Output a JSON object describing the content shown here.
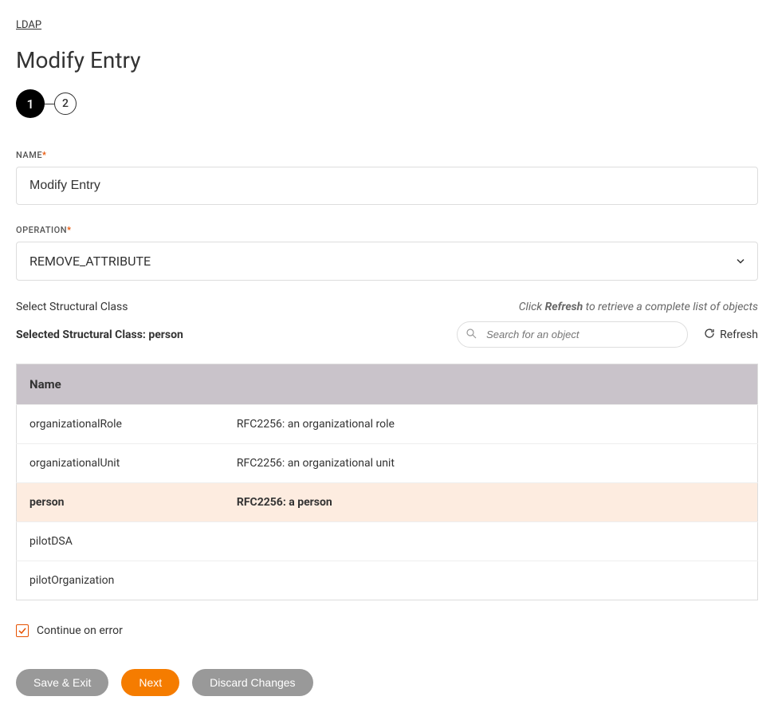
{
  "breadcrumb": "LDAP",
  "page_title": "Modify Entry",
  "stepper": {
    "step1": "1",
    "step2": "2"
  },
  "name_field": {
    "label": "NAME",
    "value": "Modify Entry"
  },
  "operation_field": {
    "label": "OPERATION",
    "value": "REMOVE_ATTRIBUTE"
  },
  "structural_class": {
    "select_label": "Select Structural Class",
    "hint_prefix": "Click ",
    "hint_strong": "Refresh",
    "hint_suffix": " to retrieve a complete list of objects",
    "selected_prefix": "Selected Structural Class: ",
    "selected_value": "person",
    "search_placeholder": "Search for an object",
    "refresh_label": "Refresh"
  },
  "table": {
    "header_name": "Name",
    "rows": [
      {
        "name": "organizationalRole",
        "desc": "RFC2256: an organizational role",
        "selected": false
      },
      {
        "name": "organizationalUnit",
        "desc": "RFC2256: an organizational unit",
        "selected": false
      },
      {
        "name": "person",
        "desc": "RFC2256: a person",
        "selected": true
      },
      {
        "name": "pilotDSA",
        "desc": "",
        "selected": false
      },
      {
        "name": "pilotOrganization",
        "desc": "",
        "selected": false
      }
    ]
  },
  "continue_on_error": {
    "label": "Continue on error",
    "checked": true
  },
  "buttons": {
    "save_exit": "Save & Exit",
    "next": "Next",
    "discard": "Discard Changes"
  }
}
